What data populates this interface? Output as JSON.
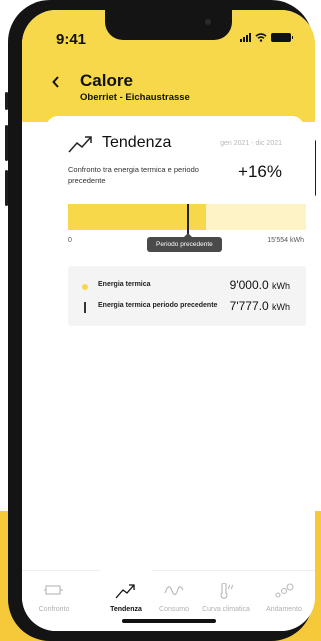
{
  "status": {
    "time": "9:41"
  },
  "header": {
    "back_icon": "chevron-left-icon",
    "title": "Calore",
    "subtitle": "Oberriet - Eichaustrasse"
  },
  "trend": {
    "icon": "trend-up-icon",
    "title": "Tendenza",
    "period": "gen 2021 - dic 2021",
    "comparison_text": "Confronto tra energia termica e periodo precedente",
    "percent": "+16%",
    "bar": {
      "min_label": "0",
      "max_label": "15'554 kWh",
      "current_fraction": 0.579,
      "previous_fraction": 0.5,
      "tooltip": "Periodo precedente",
      "colors": {
        "current": "#f6d84a",
        "background": "#fdf3c6",
        "marker": "#222222"
      }
    },
    "legend": [
      {
        "label": "Energia termica",
        "value": "9'000.0",
        "unit": "kWh"
      },
      {
        "label": "Energia termica periodo precedente",
        "value": "7'777.0",
        "unit": "kWh"
      }
    ]
  },
  "tabs": [
    {
      "label": "Confronto",
      "icon": "battery-icon",
      "active": false
    },
    {
      "label": "Tendenza",
      "icon": "trend-up-icon",
      "active": true
    },
    {
      "label": "Consumo",
      "icon": "wave-icon",
      "active": false
    },
    {
      "label": "Curva climatica",
      "icon": "thermometer-icon",
      "active": false
    },
    {
      "label": "Andamento",
      "icon": "bubbles-icon",
      "active": false
    }
  ],
  "colors": {
    "accent": "#f6d84a",
    "brand_yellow": "#f6c93a"
  }
}
